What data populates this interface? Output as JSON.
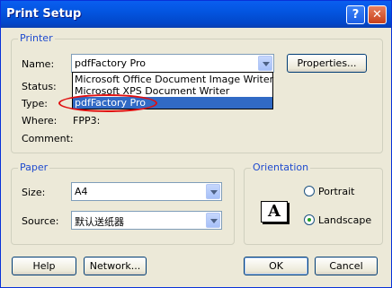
{
  "window": {
    "title": "Print Setup"
  },
  "titlebar": {
    "help_glyph": "?",
    "close_glyph": "✕"
  },
  "printer": {
    "legend": "Printer",
    "name_label": "Name:",
    "selected": "pdfFactory Pro",
    "properties_button": "Properties...",
    "status_label": "Status:",
    "type_label": "Type:",
    "where_label": "Where:",
    "where_value": "FPP3:",
    "comment_label": "Comment:",
    "options": [
      "Microsoft Office Document Image Writer",
      "Microsoft XPS Document Writer",
      "pdfFactory Pro"
    ]
  },
  "paper": {
    "legend": "Paper",
    "size_label": "Size:",
    "size_value": "A4",
    "source_label": "Source:",
    "source_value": "默认送纸器"
  },
  "orientation": {
    "legend": "Orientation",
    "icon_letter": "A",
    "portrait_label": "Portrait",
    "landscape_label": "Landscape",
    "selected": "Landscape"
  },
  "buttons": {
    "help": "Help",
    "network": "Network...",
    "ok": "OK",
    "cancel": "Cancel"
  },
  "annotation_color": "#e01010"
}
